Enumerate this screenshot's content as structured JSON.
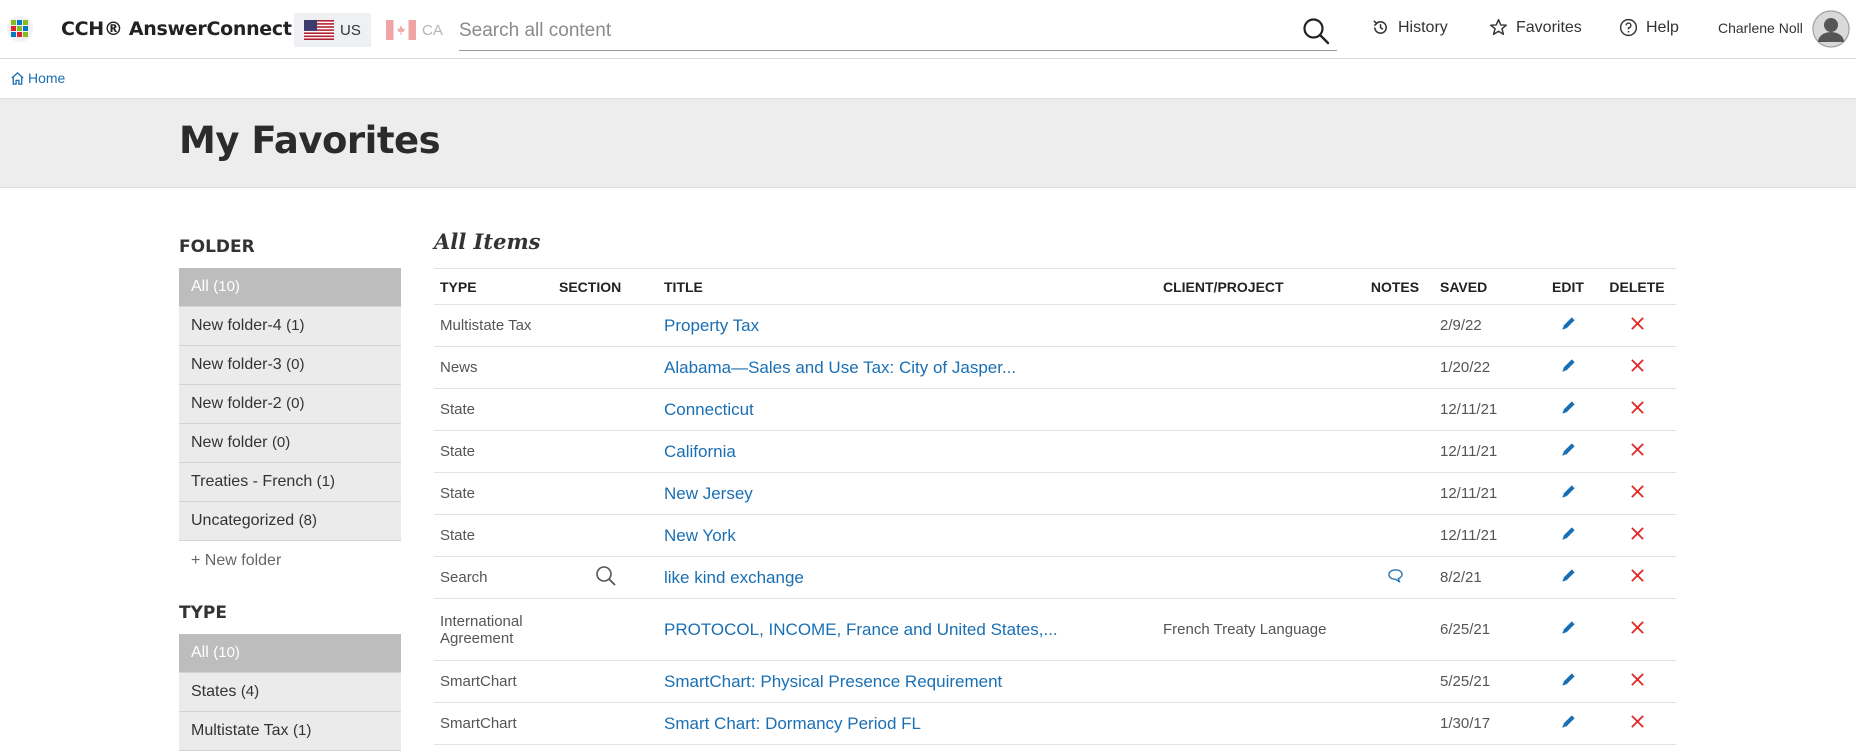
{
  "header": {
    "brand": "CCH® AnswerConnect",
    "regions": [
      {
        "code": "US",
        "active": true
      },
      {
        "code": "CA",
        "active": false
      }
    ],
    "search_placeholder": "Search all content",
    "nav": {
      "history": "History",
      "favorites": "Favorites",
      "help": "Help"
    },
    "user_name": "Charlene Noll"
  },
  "breadcrumb": {
    "home": "Home"
  },
  "page_title": "My Favorites",
  "sidebar": {
    "folder_heading": "FOLDER",
    "folders": [
      {
        "label": "All",
        "count": "(10)",
        "active": true
      },
      {
        "label": "New folder-4",
        "count": "(1)",
        "active": false
      },
      {
        "label": "New folder-3",
        "count": "(0)",
        "active": false
      },
      {
        "label": "New folder-2",
        "count": "(0)",
        "active": false
      },
      {
        "label": "New folder",
        "count": "(0)",
        "active": false
      },
      {
        "label": "Treaties - French",
        "count": "(1)",
        "active": false
      },
      {
        "label": "Uncategorized",
        "count": "(8)",
        "active": false
      }
    ],
    "new_folder": "+ New folder",
    "type_heading": "TYPE",
    "types": [
      {
        "label": "All",
        "count": "(10)",
        "active": true
      },
      {
        "label": "States",
        "count": "(4)",
        "active": false
      },
      {
        "label": "Multistate Tax",
        "count": "(1)",
        "active": false
      }
    ]
  },
  "table": {
    "title": "All Items",
    "columns": {
      "type": "TYPE",
      "section": "SECTION",
      "title": "TITLE",
      "client": "CLIENT/PROJECT",
      "notes": "NOTES",
      "saved": "SAVED",
      "edit": "EDIT",
      "delete": "DELETE"
    },
    "rows": [
      {
        "type": "Multistate Tax",
        "title": "Property Tax",
        "client": "",
        "saved": "2/9/22"
      },
      {
        "type": "News",
        "title": "Alabama—Sales and Use Tax: City of Jasper...",
        "client": "",
        "saved": "1/20/22"
      },
      {
        "type": "State",
        "title": "Connecticut",
        "client": "",
        "saved": "12/11/21"
      },
      {
        "type": "State",
        "title": "California",
        "client": "",
        "saved": "12/11/21"
      },
      {
        "type": "State",
        "title": "New Jersey",
        "client": "",
        "saved": "12/11/21"
      },
      {
        "type": "State",
        "title": "New York",
        "client": "",
        "saved": "12/11/21"
      },
      {
        "type": "Search",
        "title": "like kind exchange",
        "client": "",
        "saved": "8/2/21"
      },
      {
        "type": "International Agreement",
        "title": "PROTOCOL, INCOME, France and United States,...",
        "client": "French Treaty Language",
        "saved": "6/25/21"
      },
      {
        "type": "SmartChart",
        "title": "SmartChart: Physical Presence Requirement",
        "client": "",
        "saved": "5/25/21"
      },
      {
        "type": "SmartChart",
        "title": "Smart Chart: Dormancy Period FL",
        "client": "",
        "saved": "1/30/17"
      }
    ]
  },
  "colors": {
    "link": "#1a6fb3",
    "delete": "#e02a2a",
    "active_folder": "#bdbdbd",
    "title_band": "#ededed"
  }
}
